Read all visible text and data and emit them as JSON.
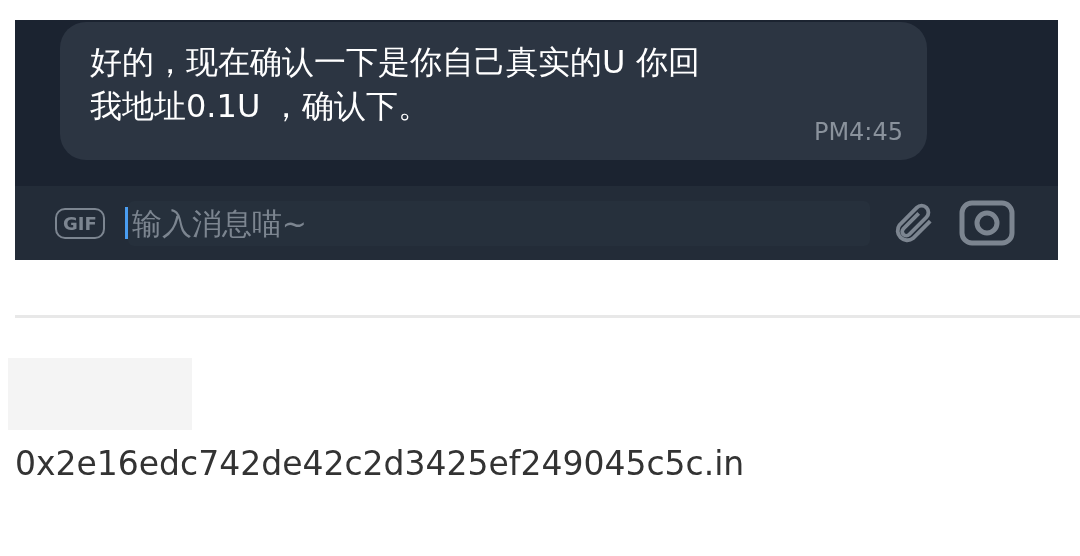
{
  "chat": {
    "message": {
      "lines": [
        "好的，现在确认一下是你自己真实的U 你回",
        "我地址0.1U ，确认下。"
      ],
      "time": "PM4:45"
    },
    "composer": {
      "gif_label": "GIF",
      "placeholder": "输入消息喵~"
    }
  },
  "address": "0x2e16edc742de42c2d3425ef249045c5c.in"
}
